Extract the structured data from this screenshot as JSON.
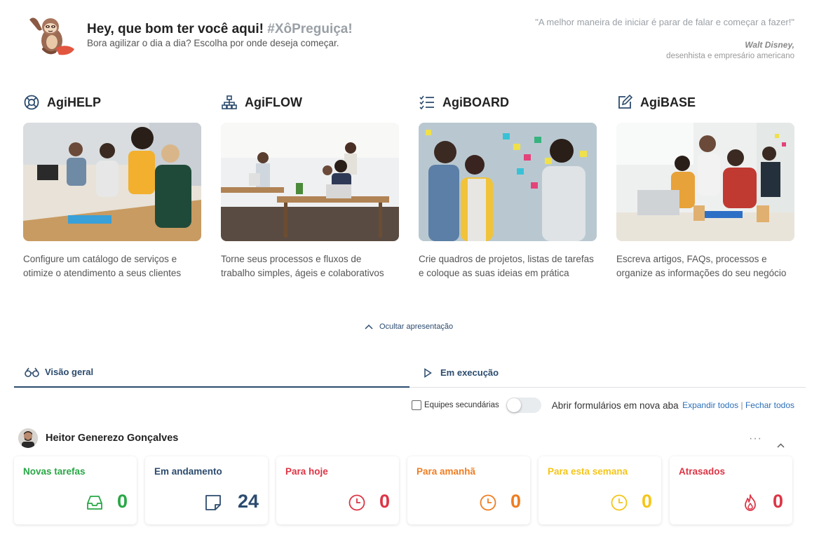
{
  "header": {
    "greeting": "Hey, que bom ter você aqui!",
    "hashtag": "#XôPreguiça!",
    "subtitle": "Bora agilizar o dia a dia? Escolha por onde deseja começar.",
    "quote": "\"A melhor maneira de iniciar é parar de falar e começar a fazer!\"",
    "quote_author": "Walt Disney,",
    "quote_author_desc": "desenhista e empresário americano"
  },
  "products": [
    {
      "name": "AgiHELP",
      "icon": "lifebuoy-icon",
      "description": "Configure um catálogo de serviços e otimize o atendimento a seus clientes"
    },
    {
      "name": "AgiFLOW",
      "icon": "sitemap-icon",
      "description": "Torne seus processos e fluxos de trabalho simples, ágeis e colaborativos"
    },
    {
      "name": "AgiBOARD",
      "icon": "checklist-icon",
      "description": "Crie quadros de projetos, listas de tarefas e coloque as suas ideias em prática"
    },
    {
      "name": "AgiBASE",
      "icon": "edit-icon",
      "description": "Escreva artigos, FAQs, processos e organize as informações do seu negócio"
    }
  ],
  "hide_presentation": "Ocultar apresentação",
  "tabs": [
    {
      "label": "Visão geral",
      "icon": "binoculars-icon",
      "active": true
    },
    {
      "label": "Em execução",
      "icon": "play-icon",
      "active": false
    }
  ],
  "options": {
    "secondary_teams": "Equipes secundárias",
    "secondary_teams_checked": false,
    "open_forms_new_tab": "Abrir formulários em nova aba",
    "open_forms_new_tab_on": false,
    "expand_all": "Expandir todos",
    "separator": "|",
    "collapse_all": "Fechar todos"
  },
  "user": {
    "name": "Heitor Generezo Gonçalves",
    "menu": "···"
  },
  "cards": [
    {
      "title": "Novas tarefas",
      "value": "0",
      "color": "#28a745",
      "icon": "inbox-icon"
    },
    {
      "title": "Em andamento",
      "value": "24",
      "color": "#2c4b6e",
      "icon": "sticky-note-icon"
    },
    {
      "title": "Para hoje",
      "value": "0",
      "color": "#dc3545",
      "icon": "clock-icon"
    },
    {
      "title": "Para amanhã",
      "value": "0",
      "color": "#ef7d22",
      "icon": "clock-icon"
    },
    {
      "title": "Para esta semana",
      "value": "0",
      "color": "#f5c518",
      "icon": "clock-icon"
    },
    {
      "title": "Atrasados",
      "value": "0",
      "color": "#dc3545",
      "icon": "fire-icon"
    }
  ]
}
